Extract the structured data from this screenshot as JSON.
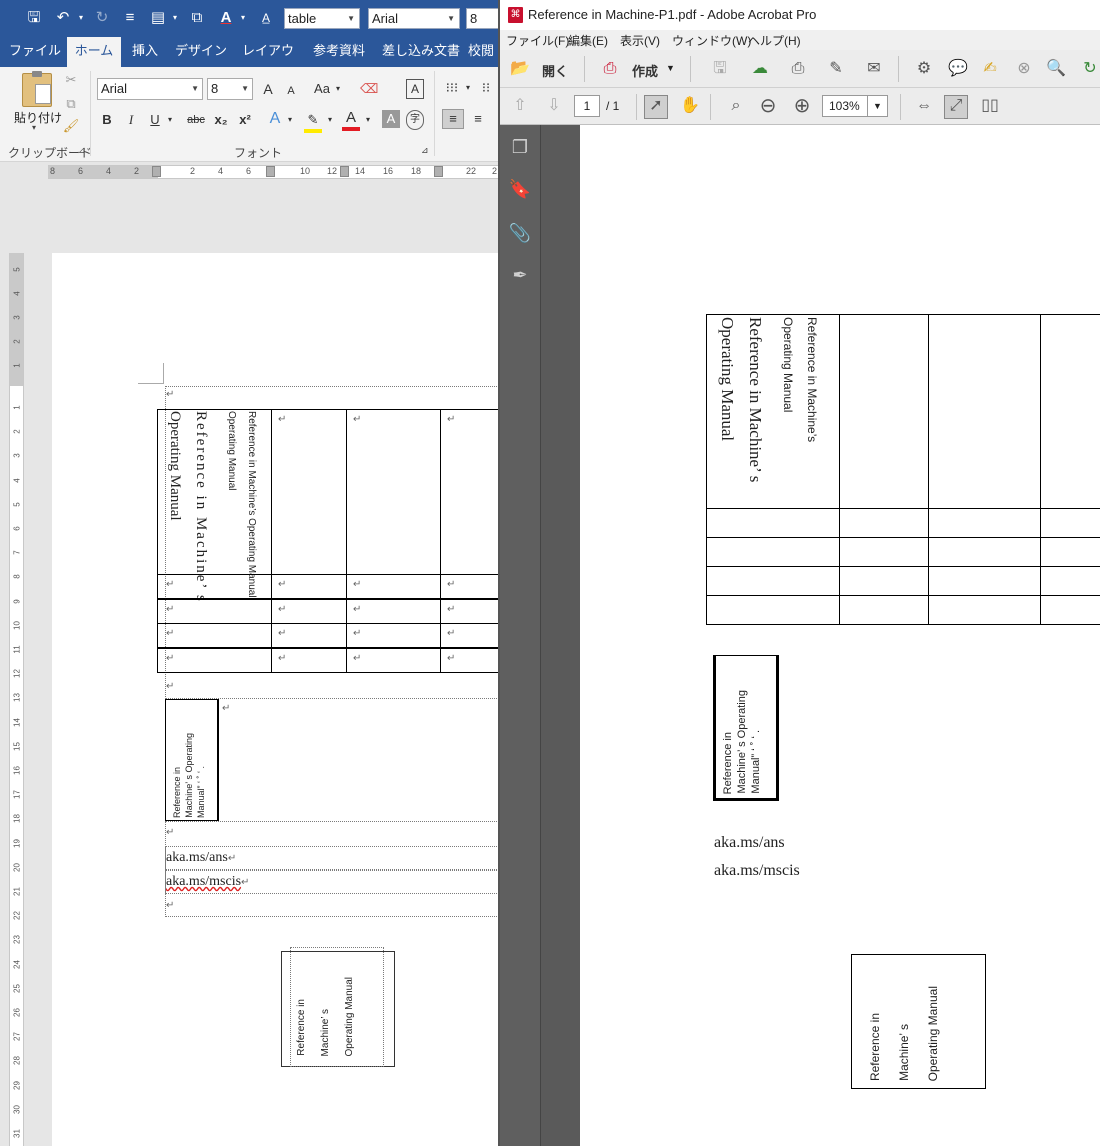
{
  "word": {
    "qat": {
      "style_input": "table",
      "font_name": "Arial",
      "font_size": "8"
    },
    "tabs": [
      "ファイル",
      "ホーム",
      "挿入",
      "デザイン",
      "レイアウト",
      "参考資料",
      "差し込み文書",
      "校閲"
    ],
    "active_tab": "ホーム",
    "ribbon": {
      "paste_label": "貼り付け",
      "clipboard_group": "クリップボード",
      "font_group": "フォント",
      "font_name": "Arial",
      "font_size": "8",
      "bold": "B",
      "italic": "I",
      "underline": "U",
      "strike": "abc",
      "subscript": "x₂",
      "superscript": "x²",
      "change_case": "Aa",
      "grow_font": "A",
      "shrink_font": "A"
    },
    "ruler_numbers": [
      "8",
      "6",
      "4",
      "2",
      "2",
      "4",
      "6",
      "10",
      "12",
      "14",
      "16",
      "18",
      "22",
      "2"
    ],
    "vruler_numbers": [
      "5",
      "4",
      "3",
      "2",
      "1",
      "1",
      "2",
      "3",
      "4",
      "5",
      "6",
      "7",
      "8",
      "9",
      "10",
      "11",
      "12",
      "13",
      "14",
      "15",
      "16",
      "17",
      "18",
      "19",
      "20",
      "21",
      "22",
      "23",
      "24",
      "25",
      "26",
      "27",
      "28",
      "29",
      "30",
      "31"
    ],
    "doc": {
      "cell_text_1": "Reference in Machine’s Operating Manual",
      "cell_text_2": "Reference in Machine’s Operating Manual",
      "cell_text_3": "Operating Manual",
      "cell_line_a": "Reference in Machine’ s",
      "cell_line_b": "Operating Manual",
      "box2_lines": [
        "Reference in",
        "Machine’ s Operating",
        "Manual” ‘ ˚ ‘ ."
      ],
      "link1": "aka.ms/ans",
      "link2": "aka.ms/mscis",
      "box3_lines": [
        "Reference in",
        "Machine’ s",
        "Operating Manual"
      ],
      "return_mark": "↵"
    }
  },
  "acrobat": {
    "title": "Reference in Machine-P1.pdf - Adobe Acrobat Pro",
    "menu": [
      "ファイル(F)",
      "編集(E)",
      "表示(V)",
      "ウィンドウ(W)",
      "ヘルプ(H)"
    ],
    "toolbar": {
      "open_label": "開く",
      "create_label": "作成",
      "page_current": "1",
      "page_total": "/ 1",
      "zoom": "103%"
    },
    "page": {
      "small_line_1": "Reference in Machine’s",
      "small_line_2": "Operating Manual",
      "big_line_1": "Reference  in  Machine’ s",
      "big_line_2": "Operating Manual",
      "box2_lines": [
        "Reference in",
        "Machine’ s Operating",
        "Manual” ‘ ˚ ‘ ."
      ],
      "link1": "aka.ms/ans",
      "link2": "aka.ms/mscis",
      "box3_lines": [
        "Reference in",
        "Machine’ s",
        "Operating Manual"
      ]
    }
  }
}
